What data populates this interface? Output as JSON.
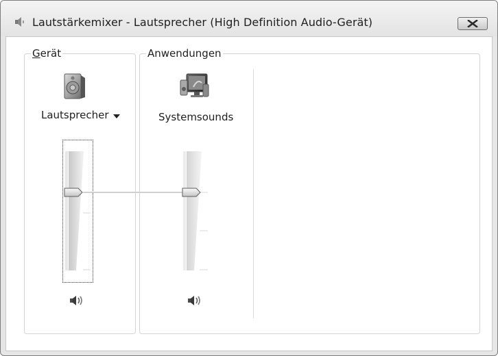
{
  "window": {
    "title": "Lautstärkemixer - Lautsprecher (High Definition Audio-Gerät)",
    "close_icon": "close-icon",
    "app_icon": "speaker-icon"
  },
  "device_group": {
    "label_accel": "G",
    "label_rest": "erät",
    "device_icon": "speaker-device-icon",
    "device_name": "Lautsprecher",
    "dropdown_icon": "chevron-down-icon",
    "volume_level": 0.67,
    "mute_icon": "speaker-volume-icon"
  },
  "apps_group": {
    "label": "Anwendungen",
    "apps": [
      {
        "name": "Systemsounds",
        "icon": "system-sounds-icon",
        "volume_level": 0.67,
        "mute_icon": "speaker-volume-icon"
      }
    ]
  }
}
